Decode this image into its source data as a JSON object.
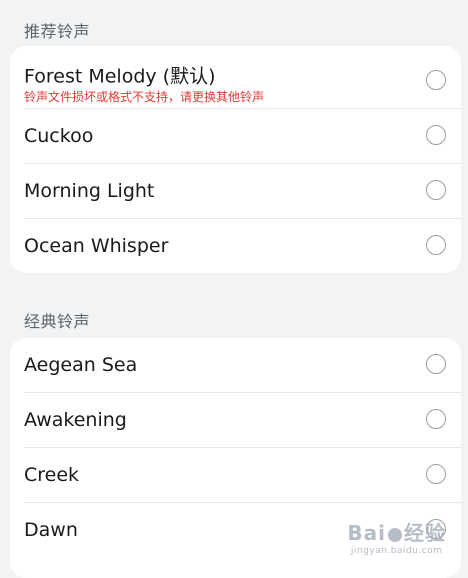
{
  "sections": [
    {
      "title": "推荐铃声",
      "items": [
        {
          "label": "Forest Melody (默认)",
          "error": "铃声文件损坏或格式不支持，请更换其他铃声",
          "selected": false
        },
        {
          "label": "Cuckoo",
          "selected": false
        },
        {
          "label": "Morning Light",
          "selected": false
        },
        {
          "label": "Ocean Whisper",
          "selected": false
        }
      ]
    },
    {
      "title": "经典铃声",
      "items": [
        {
          "label": "Aegean Sea",
          "selected": false
        },
        {
          "label": "Awakening",
          "selected": false
        },
        {
          "label": "Creek",
          "selected": false
        },
        {
          "label": "Dawn",
          "selected": false
        }
      ]
    }
  ],
  "watermark": {
    "top_left": "Bai",
    "top_right": "经验",
    "bottom": "jingyan.baidu.com"
  },
  "colors": {
    "background": "#f1f3f5",
    "card": "#ffffff",
    "error": "#e53935",
    "section_title": "#5f6368"
  }
}
